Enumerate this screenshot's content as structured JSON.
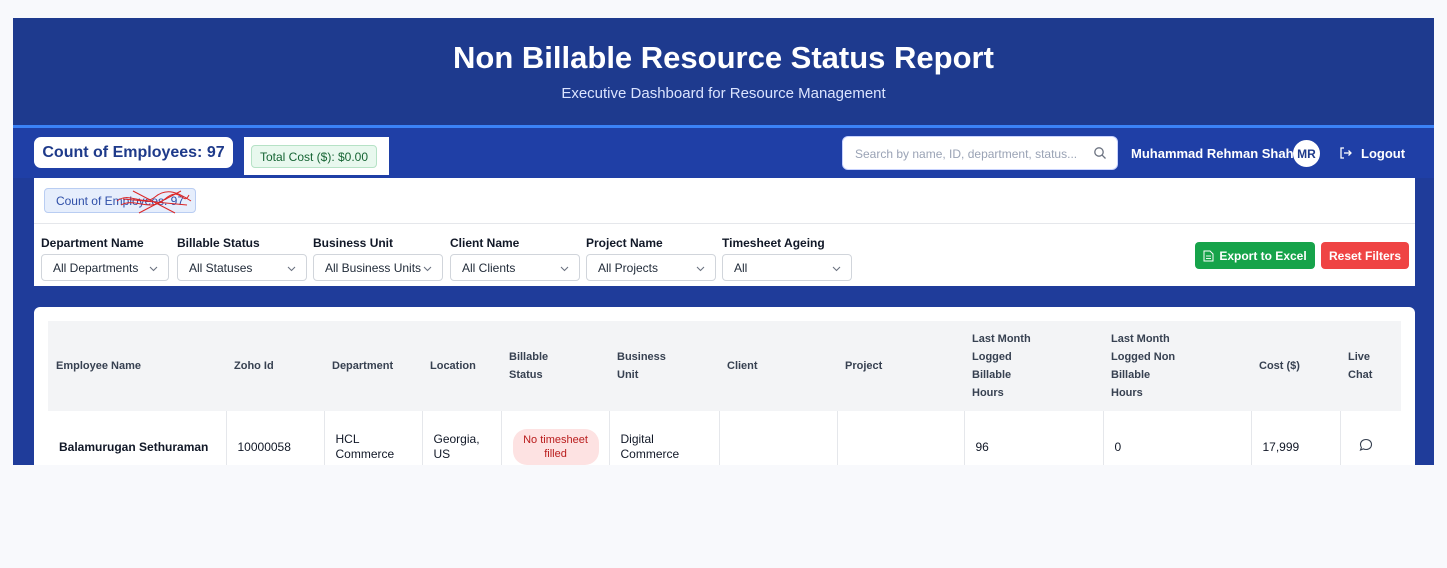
{
  "header": {
    "title": "Non Billable Resource Status Report",
    "subtitle": "Executive Dashboard for Resource Management"
  },
  "topbar": {
    "employee_count": "Count of Employees: 97",
    "total_cost": "Total Cost ($): $0.00",
    "search_placeholder": "Search by name, ID, department, status...",
    "user_name": "Muhammad Rehman Shahid",
    "user_initials": "MR",
    "logout_label": "Logout"
  },
  "filter_panel": {
    "count_tag": "Count of Employees: 97",
    "filters": [
      {
        "label": "Department Name",
        "value": "All Departments"
      },
      {
        "label": "Billable Status",
        "value": "All Statuses"
      },
      {
        "label": "Business Unit",
        "value": "All Business Units"
      },
      {
        "label": "Client Name",
        "value": "All Clients"
      },
      {
        "label": "Project Name",
        "value": "All Projects"
      },
      {
        "label": "Timesheet Ageing",
        "value": "All"
      }
    ],
    "export_label": "Export to Excel",
    "reset_label": "Reset Filters"
  },
  "table": {
    "columns": [
      "Employee Name",
      "Zoho Id",
      "Department",
      "Location",
      "Billable Status",
      "Business Unit",
      "Client",
      "Project",
      "Last Month Logged Billable Hours",
      "Last Month Logged Non Billable Hours",
      "Cost ($)",
      "Live Chat"
    ],
    "rows": [
      {
        "employee_name": "Balamurugan Sethuraman",
        "zoho_id": "10000058",
        "department": "HCL Commerce",
        "location": "Georgia, US",
        "billable_status": "No timesheet filled",
        "business_unit": "Digital Commerce",
        "client": "",
        "project": "",
        "billable_hours": "96",
        "non_billable_hours": "0",
        "cost": "17,999"
      }
    ]
  },
  "colors": {
    "header_bg": "#1e3a8e",
    "accent": "#3b82f6",
    "export_green": "#16a34a",
    "reset_red": "#ef4444",
    "status_pill_bg": "#fde2e2",
    "status_pill_text": "#b91c1c"
  }
}
